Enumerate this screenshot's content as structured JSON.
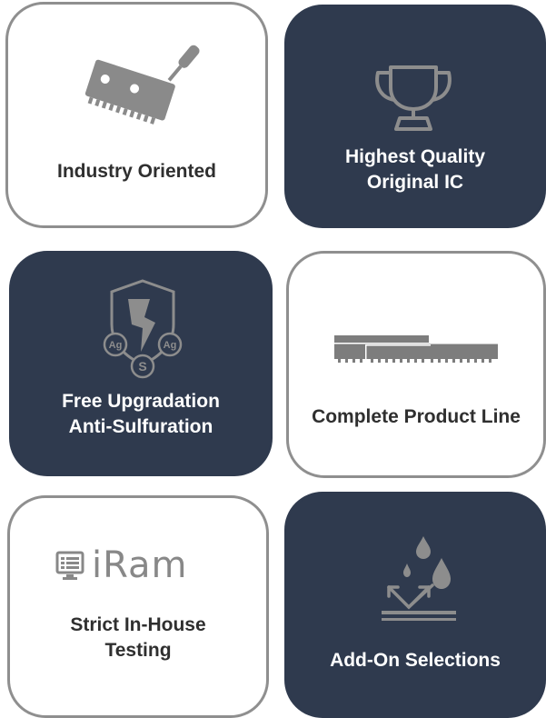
{
  "features": [
    {
      "label": "Industry Oriented",
      "icon": "circuit-board-screwdriver-icon",
      "theme": "light"
    },
    {
      "label": "Highest Quality\nOriginal IC",
      "icon": "trophy-icon",
      "theme": "dark"
    },
    {
      "label": "Free Upgradation\nAnti-Sulfuration",
      "icon": "shield-ag-s-icon",
      "theme": "dark"
    },
    {
      "label": "Complete Product Line",
      "icon": "memory-modules-icon",
      "theme": "light"
    },
    {
      "label": "Strict In-House\nTesting",
      "icon": "iram-logo",
      "theme": "light"
    },
    {
      "label": "Add-On Selections",
      "icon": "water-drops-protection-icon",
      "theme": "dark"
    }
  ],
  "logo_text": "iRam",
  "shield_letters": {
    "left": "Ag",
    "bottom": "S",
    "right": "Ag"
  },
  "colors": {
    "dark_card": "#2f3a4e",
    "light_border": "#8f8f8f",
    "icon_gray": "#888888",
    "dark_text": "#2f2f2f"
  }
}
